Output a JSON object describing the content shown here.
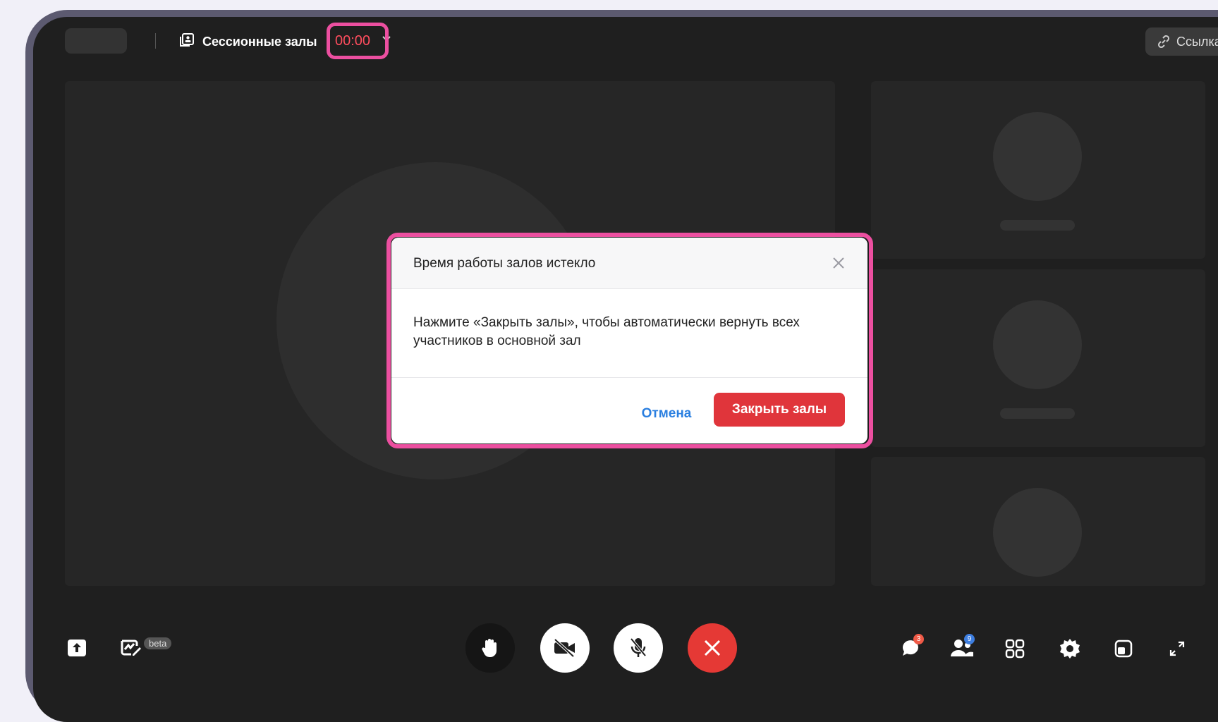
{
  "header": {
    "rooms_title": "Сессионные залы",
    "separator": "·",
    "timer": "00:00",
    "link_label": "Ссылка"
  },
  "dialog": {
    "title": "Время работы залов истекло",
    "body": "Нажмите «Закрыть залы», чтобы автоматически вернуть всех участников в основной зал",
    "cancel_label": "Отмена",
    "confirm_label": "Закрыть залы"
  },
  "toolbar": {
    "beta_label": "beta",
    "chat_badge": "3",
    "participants_badge": "9"
  },
  "colors": {
    "highlight": "#ec4fa0",
    "timer": "#ff4d5e",
    "danger": "#e0353b",
    "link": "#2a7fe0"
  }
}
